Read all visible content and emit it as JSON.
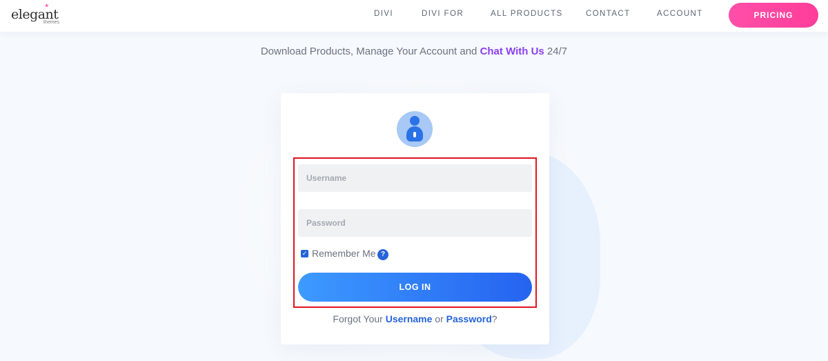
{
  "header": {
    "logo_text": "elegant",
    "logo_subtext": "themes",
    "nav": [
      "DIVI",
      "DIVI FOR",
      "ALL PRODUCTS",
      "CONTACT",
      "ACCOUNT"
    ],
    "pricing_label": "PRICING"
  },
  "tagline": {
    "prefix": "Download Products, Manage Your Account and ",
    "link": "Chat With Us",
    "suffix": " 24/7"
  },
  "login": {
    "username_placeholder": "Username",
    "username_value": "",
    "password_placeholder": "Password",
    "password_value": "",
    "remember_label": "Remember Me",
    "remember_checked": true,
    "help_glyph": "?",
    "submit_label": "LOG IN",
    "forgot": {
      "prefix": "Forgot Your ",
      "username_link": "Username",
      "middle": " or ",
      "password_link": "Password",
      "suffix": "?"
    }
  },
  "icons": {
    "avatar": "user-lock-icon",
    "help": "help-icon",
    "check": "checkbox-icon",
    "logo_star": "star-icon"
  },
  "colors": {
    "accent_pink": "#ff3d9a",
    "accent_purple": "#8a3ff0",
    "accent_blue": "#2563d9",
    "highlight_red": "#e0141e"
  }
}
